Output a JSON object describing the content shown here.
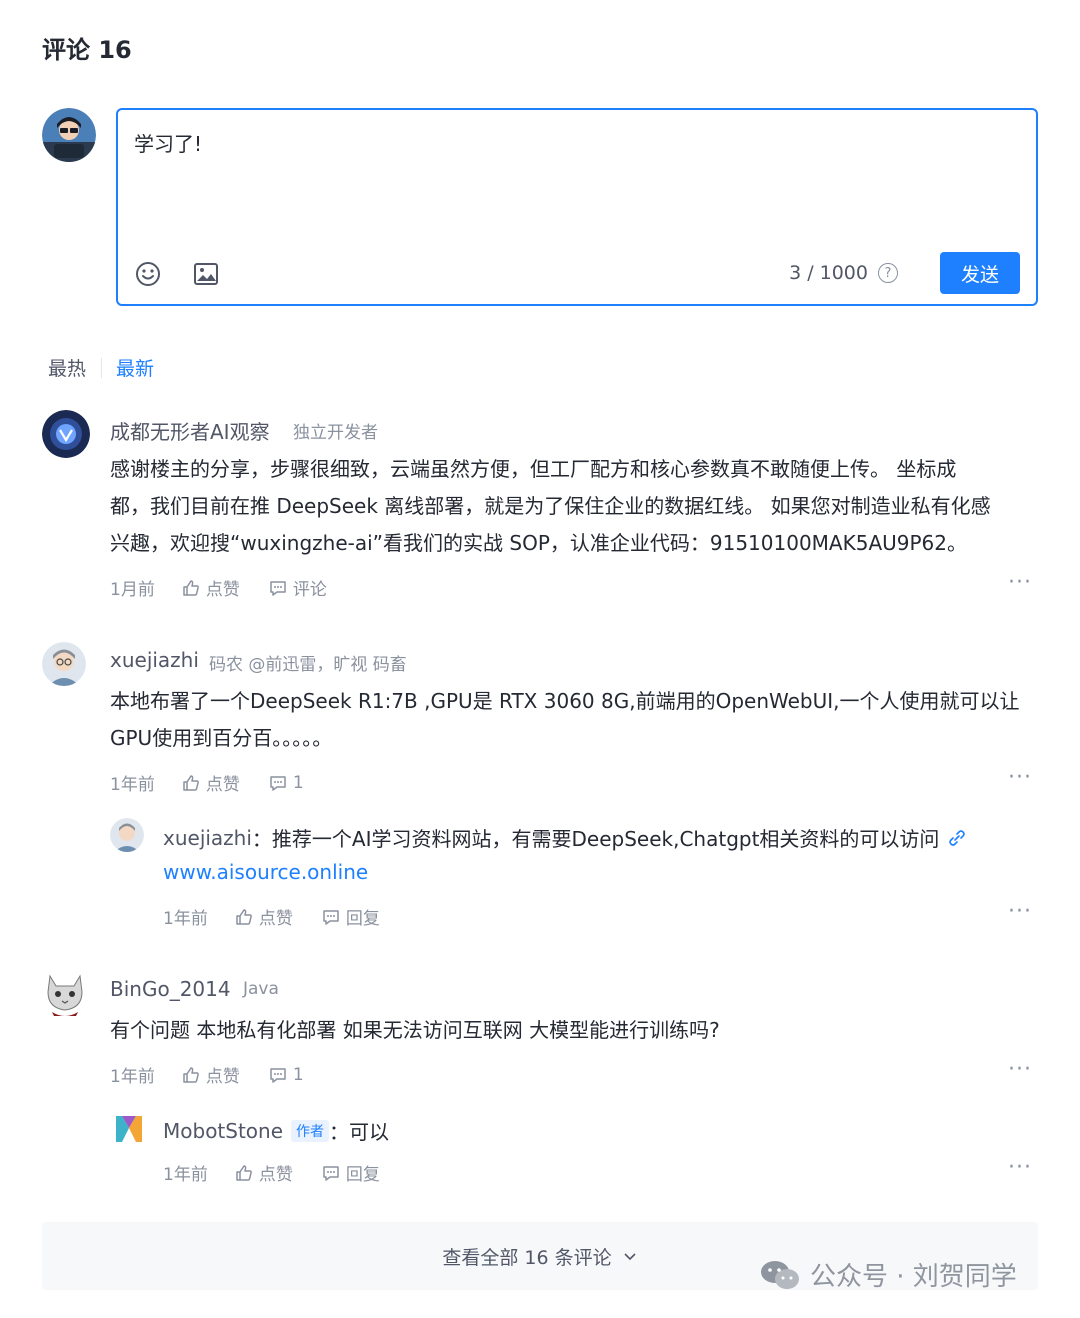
{
  "header": {
    "title": "评论 16"
  },
  "editor": {
    "text": "学习了!",
    "counter": "3 / 1000",
    "help_glyph": "?",
    "send_label": "发送",
    "emoji_icon": "smile-icon",
    "image_icon": "image-icon"
  },
  "sort": {
    "hot": "最热",
    "new": "最新"
  },
  "comments": [
    {
      "name": "成都无形者AI观察",
      "tag": "独立开发者",
      "lines": [
        "感谢楼主的分享，步骤很细致，云端虽然方便，但工厂配方和核心参数真不敢随便上传。 坐标成",
        "都，我们目前在推 DeepSeek 离线部署，就是为了保住企业的数据红线。 如果您对制造业私有化感",
        "兴趣，欢迎搜“wuxingzhe-ai”看我们的实战 SOP，认准企业代码：91510100MAK5AU9P62。"
      ],
      "time": "1月前",
      "like": "点赞",
      "reply": "评论"
    },
    {
      "name": "xuejiazhi",
      "tag": "码农 @前迅雷，旷视 码畜",
      "lines": [
        "本地布署了一个DeepSeek R1:7B ,GPU是 RTX 3060 8G,前端用的OpenWebUI,一个人使用就可以让",
        "GPU使用到百分百。。。。。"
      ],
      "time": "1年前",
      "like": "点赞",
      "reply": "1",
      "sub": {
        "name": "xuejiazhi",
        "text": "：推荐一个AI学习资料网站，有需要DeepSeek,Chatgpt相关资料的可以访问",
        "link": "www.aisource.online",
        "time": "1年前",
        "like": "点赞",
        "reply": "回复"
      }
    },
    {
      "name": "BinGo_2014",
      "tag": "Java",
      "lines": [
        "有个问题 本地私有化部署 如果无法访问互联网 大模型能进行训练吗?"
      ],
      "time": "1年前",
      "like": "点赞",
      "reply": "1",
      "sub": {
        "name": "MobotStone",
        "badge": "作者",
        "text": "：可以",
        "time": "1年前",
        "like": "点赞",
        "reply": "回复"
      }
    }
  ],
  "more": "···",
  "footer": {
    "view_all": "查看全部 16 条评论"
  },
  "watermark": {
    "text": "公众号 · 刘贺同学"
  },
  "colors": {
    "accent": "#1e80ff",
    "muted": "#8a919f",
    "text": "#252933"
  }
}
